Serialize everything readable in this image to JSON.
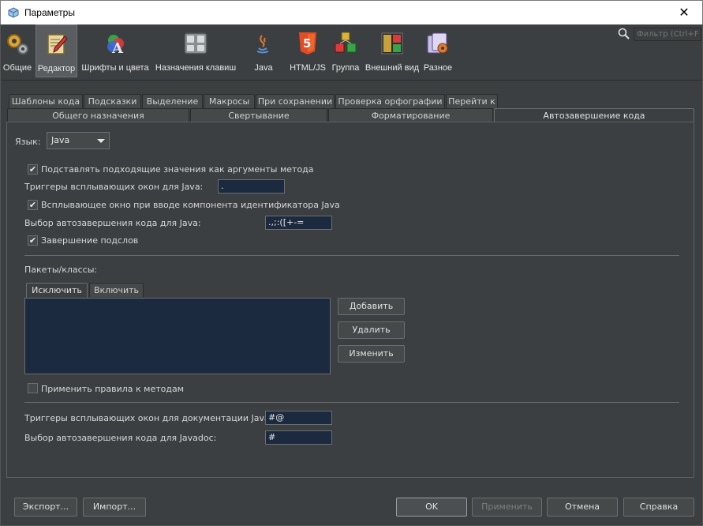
{
  "window": {
    "title": "Параметры",
    "close_glyph": "✕",
    "app_icon": "netbeans-cube-icon"
  },
  "categories": [
    {
      "label": "Общие",
      "icon": "gears-icon"
    },
    {
      "label": "Редактор",
      "icon": "editor-icon",
      "selected": true
    },
    {
      "label": "Шрифты и цвета",
      "icon": "fonts-colors-icon"
    },
    {
      "label": "Назначения клавиш",
      "icon": "keyboard-icon"
    },
    {
      "label": "Java",
      "icon": "java-icon"
    },
    {
      "label": "HTML/JS",
      "icon": "html5-icon"
    },
    {
      "label": "Группа",
      "icon": "group-icon"
    },
    {
      "label": "Внешний вид",
      "icon": "appearance-icon"
    },
    {
      "label": "Разное",
      "icon": "misc-icon"
    }
  ],
  "filter": {
    "placeholder": "Фильтр (Ctrl+F)"
  },
  "tabs_row1": [
    "Шаблоны кода",
    "Подсказки",
    "Выделение",
    "Макросы",
    "При сохранении",
    "Проверка орфографии",
    "Перейти к"
  ],
  "tabs_row2": [
    "Общего назначения",
    "Свертывание",
    "Форматирование",
    "Автозавершение кода"
  ],
  "active_tab": "Автозавершение кода",
  "content": {
    "language_label": "Язык:",
    "language_value": "Java",
    "opt_method_args": "Подставлять подходящие значения как аргументы метода",
    "opt_method_args_checked": true,
    "popup_triggers_label": "Триггеры всплывающих окон для Java:",
    "popup_triggers_value": ".",
    "opt_popup_on_identifier": "Всплывающее окно при вводе компонента идентификатора Java",
    "opt_popup_on_identifier_checked": true,
    "selectors_label": "Выбор автозавершения кода для Java:",
    "selectors_value": ".,;:([+-=",
    "opt_subword": "Завершение подслов",
    "opt_subword_checked": true,
    "packages_label": "Пакеты/классы:",
    "subtab_exclude": "Исключить",
    "subtab_include": "Включить",
    "btn_add": "Добавить",
    "btn_remove": "Удалить",
    "btn_edit": "Изменить",
    "opt_apply_methods": "Применить правила к методам",
    "opt_apply_methods_checked": false,
    "javadoc_triggers_label": "Триггеры всплывающих окон для документации Javadoc:",
    "javadoc_triggers_value": "#@",
    "javadoc_selectors_label": "Выбор автозавершения кода для Javadoc:",
    "javadoc_selectors_value": "#"
  },
  "footer": {
    "export": "Экспорт...",
    "import": "Импорт...",
    "ok": "OK",
    "apply": "Применить",
    "cancel": "Отмена",
    "help": "Справка"
  }
}
